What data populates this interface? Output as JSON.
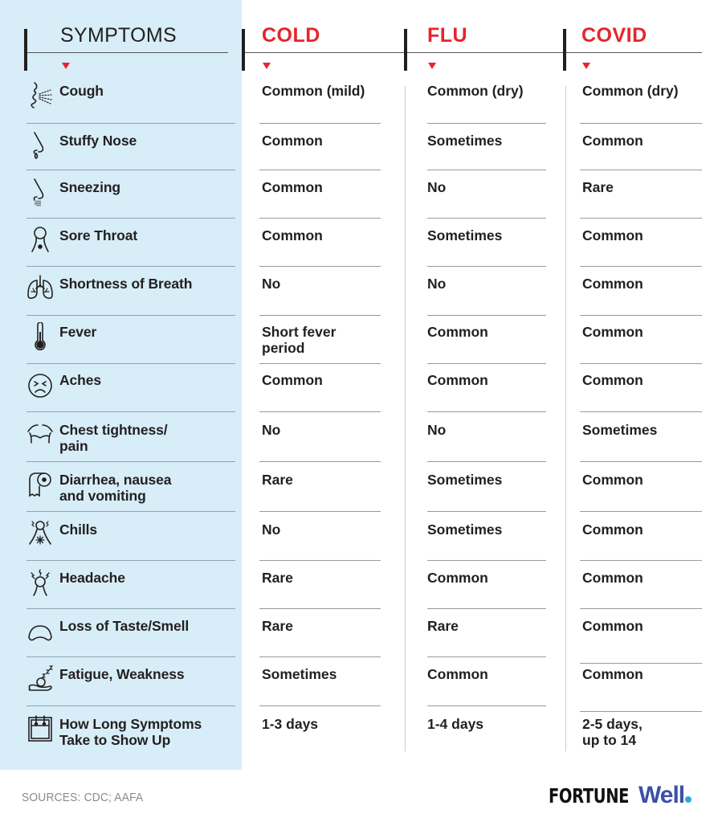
{
  "header": {
    "symptoms_label": "SYMPTOMS",
    "columns": [
      "COLD",
      "FLU",
      "COVID"
    ]
  },
  "colors": {
    "accent_red": "#e8242b",
    "sidebar_bg": "#d7eef8",
    "brand_blue": "#3d4fa8",
    "brand_dot": "#2aa8e0"
  },
  "rows": [
    {
      "icon": "cough-icon",
      "symptom": "Cough",
      "cold": "Common (mild)",
      "flu": "Common (dry)",
      "covid": "Common (dry)"
    },
    {
      "icon": "stuffy-nose-icon",
      "symptom": "Stuffy Nose",
      "cold": "Common",
      "flu": "Sometimes",
      "covid": "Common"
    },
    {
      "icon": "sneezing-icon",
      "symptom": "Sneezing",
      "cold": "Common",
      "flu": "No",
      "covid": "Rare"
    },
    {
      "icon": "sore-throat-icon",
      "symptom": "Sore Throat",
      "cold": "Common",
      "flu": "Sometimes",
      "covid": "Common"
    },
    {
      "icon": "lungs-icon",
      "symptom": "Shortness of Breath",
      "cold": "No",
      "flu": "No",
      "covid": "Common"
    },
    {
      "icon": "thermometer-icon",
      "symptom": "Fever",
      "cold": "Short fever period",
      "flu": "Common",
      "covid": "Common"
    },
    {
      "icon": "pained-face-icon",
      "symptom": "Aches",
      "cold": "Common",
      "flu": "Common",
      "covid": "Common"
    },
    {
      "icon": "chest-icon",
      "symptom": "Chest tightness/ pain",
      "cold": "No",
      "flu": "No",
      "covid": "Sometimes"
    },
    {
      "icon": "toilet-paper-icon",
      "symptom": "Diarrhea, nausea and vomiting",
      "cold": "Rare",
      "flu": "Sometimes",
      "covid": "Common"
    },
    {
      "icon": "chills-icon",
      "symptom": "Chills",
      "cold": "No",
      "flu": "Sometimes",
      "covid": "Common"
    },
    {
      "icon": "headache-icon",
      "symptom": "Headache",
      "cold": "Rare",
      "flu": "Common",
      "covid": "Common"
    },
    {
      "icon": "nose-icon",
      "symptom": "Loss of Taste/Smell",
      "cold": "Rare",
      "flu": "Rare",
      "covid": "Common"
    },
    {
      "icon": "sleeping-icon",
      "symptom": "Fatigue, Weakness",
      "cold": "Sometimes",
      "flu": "Common",
      "covid": "Common"
    },
    {
      "icon": "calendar-icon",
      "symptom": "How Long Symptoms Take to Show Up",
      "cold": "1-3 days",
      "flu": "1-4 days",
      "covid": "2-5 days, up to 14"
    }
  ],
  "footer": {
    "sources": "SOURCES: CDC; AAFA",
    "logo_part1": "FORTUNE",
    "logo_part2": "Well"
  }
}
